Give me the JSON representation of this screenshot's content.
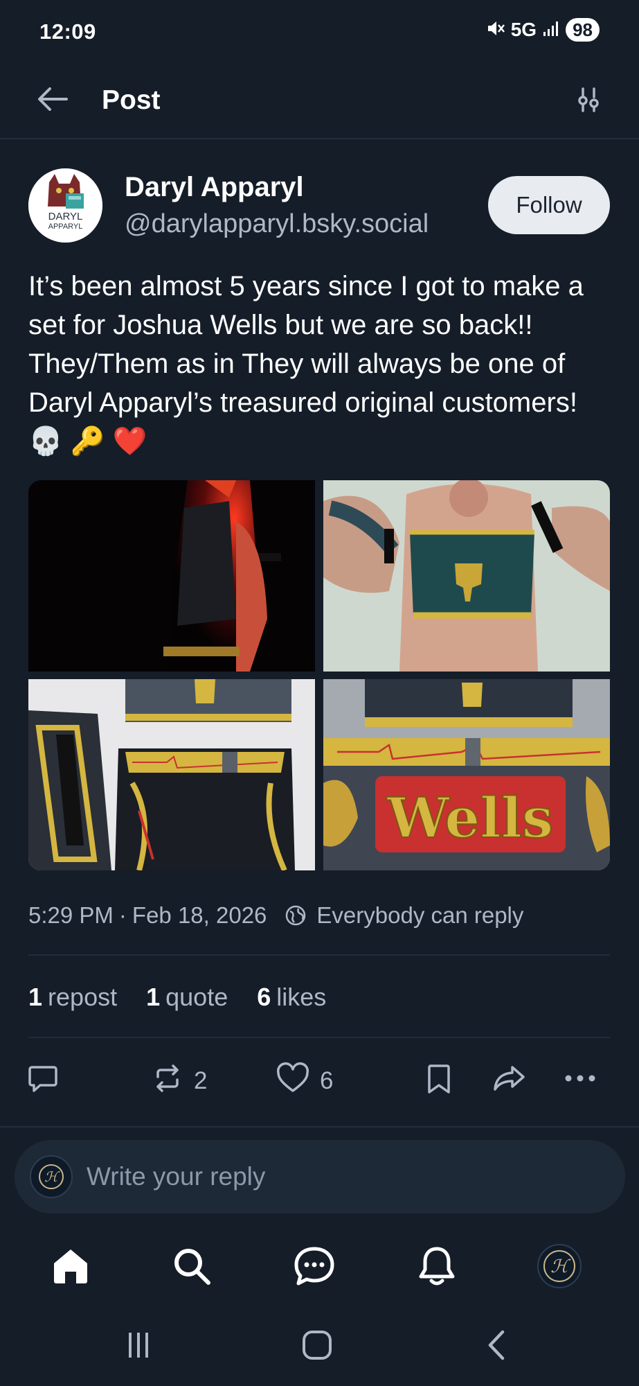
{
  "status_bar": {
    "time": "12:09",
    "network": "5G",
    "battery": "98"
  },
  "header": {
    "title": "Post",
    "back_icon": "arrow-left-icon",
    "settings_icon": "sliders-icon"
  },
  "post": {
    "author_name": "Daryl Apparyl",
    "author_handle": "@darylapparyl.bsky.social",
    "avatar_text_line1": "DARYL",
    "avatar_text_line2": "APPARYL",
    "follow_label": "Follow",
    "text": "It’s been almost 5 years since I got to make a set for Joshua Wells but we are so back!! They/Them as in They will always be one of Daryl Apparyl’s treasured original customers! 💀 🔑 ❤️",
    "image_word": "Wells",
    "time": "5:29 PM",
    "separator": "·",
    "date": "Feb 18, 2026",
    "reply_setting": "Everybody can reply",
    "reposts_count": "1",
    "reposts_label": "repost",
    "quotes_count": "1",
    "quotes_label": "quote",
    "likes_count": "6",
    "likes_label": "likes",
    "action_repost_count": "2",
    "action_like_count": "6"
  },
  "reply": {
    "placeholder": "Write your reply"
  },
  "colors": {
    "background": "#151d28",
    "muted_text": "#aeb8c6",
    "divider": "#222d3b",
    "follow_bg": "#e8ecf1"
  }
}
